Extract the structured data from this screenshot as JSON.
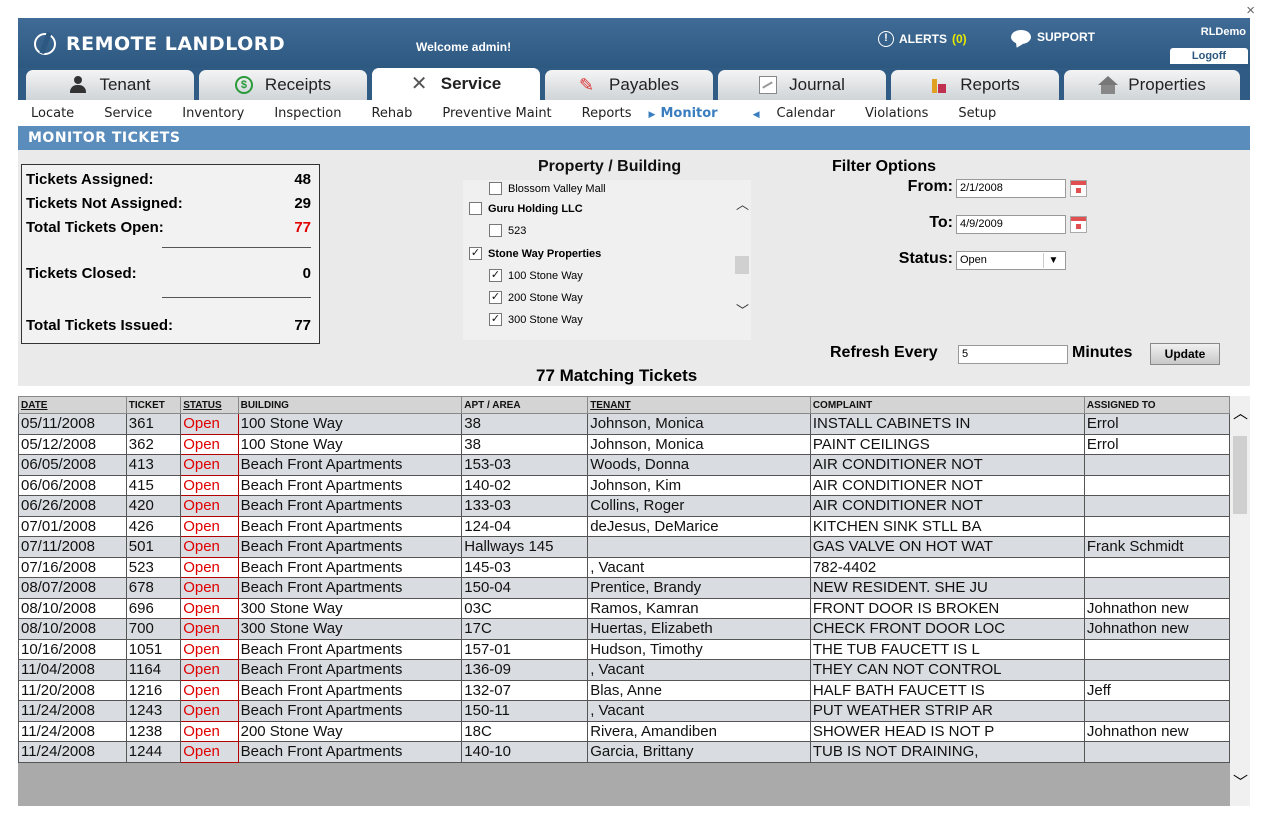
{
  "window": {
    "close_glyph": "×"
  },
  "header": {
    "brand": "REMOTE LANDLORD",
    "welcome": "Welcome admin!",
    "alerts_label": "ALERTS",
    "alerts_count": "(0)",
    "support_label": "SUPPORT",
    "user": "RLDemo",
    "logoff": "Logoff"
  },
  "tabs": [
    {
      "label": "Tenant",
      "icon": "person-icon"
    },
    {
      "label": "Receipts",
      "icon": "dollar-icon"
    },
    {
      "label": "Service",
      "icon": "tools-icon"
    },
    {
      "label": "Payables",
      "icon": "pen-icon"
    },
    {
      "label": "Journal",
      "icon": "chart-line-icon"
    },
    {
      "label": "Reports",
      "icon": "bar-chart-icon"
    },
    {
      "label": "Properties",
      "icon": "house-icon"
    }
  ],
  "subnav": [
    "Locate",
    "Service",
    "Inventory",
    "Inspection",
    "Rehab",
    "Preventive Maint",
    "Reports",
    "Monitor",
    "Calendar",
    "Violations",
    "Setup"
  ],
  "section_title": "MONITOR TICKETS",
  "summary": {
    "assigned_label": "Tickets Assigned:",
    "assigned": "48",
    "not_assigned_label": "Tickets Not Assigned:",
    "not_assigned": "29",
    "open_label": "Total Tickets Open:",
    "open": "77",
    "closed_label": "Tickets Closed:",
    "closed": "0",
    "issued_label": "Total Tickets Issued:",
    "issued": "77"
  },
  "property": {
    "title": "Property / Building",
    "items": [
      "Blossom Valley Mall",
      "Guru Holding LLC",
      "523",
      "Stone Way Properties",
      "100 Stone Way",
      "200 Stone Way",
      "300 Stone Way"
    ]
  },
  "filter": {
    "title": "Filter Options",
    "from_label": "From:",
    "from": "2/1/2008",
    "to_label": "To:",
    "to": "4/9/2009",
    "status_label": "Status:",
    "status": "Open",
    "refresh_label": "Refresh Every",
    "refresh": "5",
    "minutes_label": "Minutes",
    "update": "Update"
  },
  "matching": "77 Matching Tickets",
  "table": {
    "headers": [
      "DATE",
      "TICKET",
      "STATUS",
      "BUILDING",
      "APT / AREA",
      "TENANT",
      "COMPLAINT",
      "ASSIGNED TO"
    ],
    "rows": [
      [
        "05/11/2008",
        "361",
        "Open",
        "100 Stone Way",
        "38",
        "Johnson, Monica",
        "INSTALL CABINETS IN",
        "Errol"
      ],
      [
        "05/12/2008",
        "362",
        "Open",
        "100 Stone Way",
        "38",
        "Johnson, Monica",
        "PAINT CEILINGS",
        "Errol"
      ],
      [
        "06/05/2008",
        "413",
        "Open",
        "Beach Front Apartments",
        "153-03",
        "Woods, Donna",
        "AIR CONDITIONER NOT",
        ""
      ],
      [
        "06/06/2008",
        "415",
        "Open",
        "Beach Front Apartments",
        "140-02",
        "Johnson, Kim",
        "AIR CONDITIONER NOT",
        ""
      ],
      [
        "06/26/2008",
        "420",
        "Open",
        "Beach Front Apartments",
        "133-03",
        "Collins, Roger",
        "AIR CONDITIONER NOT",
        ""
      ],
      [
        "07/01/2008",
        "426",
        "Open",
        "Beach Front Apartments",
        "124-04",
        "deJesus, DeMarice",
        "KITCHEN SINK STLL BA",
        ""
      ],
      [
        "07/11/2008",
        "501",
        "Open",
        "Beach Front Apartments",
        "Hallways 145",
        "",
        "GAS VALVE ON HOT WAT",
        "Frank Schmidt"
      ],
      [
        "07/16/2008",
        "523",
        "Open",
        "Beach Front Apartments",
        "145-03",
        ", Vacant",
        "782-4402",
        ""
      ],
      [
        "08/07/2008",
        "678",
        "Open",
        "Beach Front Apartments",
        "150-04",
        "Prentice, Brandy",
        "NEW RESIDENT. SHE JU",
        ""
      ],
      [
        "08/10/2008",
        "696",
        "Open",
        "300 Stone Way",
        "03C",
        "Ramos, Kamran",
        "FRONT DOOR IS BROKEN",
        "Johnathon new"
      ],
      [
        "08/10/2008",
        "700",
        "Open",
        "300 Stone Way",
        "17C",
        "Huertas, Elizabeth",
        "CHECK FRONT DOOR LOC",
        "Johnathon new"
      ],
      [
        "10/16/2008",
        "1051",
        "Open",
        "Beach Front Apartments",
        "157-01",
        "Hudson, Timothy",
        "THE TUB FAUCETT IS L",
        ""
      ],
      [
        "11/04/2008",
        "1164",
        "Open",
        "Beach Front Apartments",
        "136-09",
        ", Vacant",
        "THEY CAN NOT CONTROL",
        ""
      ],
      [
        "11/20/2008",
        "1216",
        "Open",
        "Beach Front Apartments",
        "132-07",
        "Blas, Anne",
        "HALF BATH FAUCETT IS",
        "Jeff"
      ],
      [
        "11/24/2008",
        "1243",
        "Open",
        "Beach Front Apartments",
        "150-11",
        ", Vacant",
        "PUT WEATHER STRIP AR",
        ""
      ],
      [
        "11/24/2008",
        "1238",
        "Open",
        "200 Stone Way",
        "18C",
        "Rivera, Amandiben",
        "SHOWER HEAD IS NOT P",
        "Johnathon new"
      ],
      [
        "11/24/2008",
        "1244",
        "Open",
        "Beach Front Apartments",
        "140-10",
        "Garcia, Brittany",
        "TUB IS NOT DRAINING,",
        ""
      ]
    ]
  }
}
